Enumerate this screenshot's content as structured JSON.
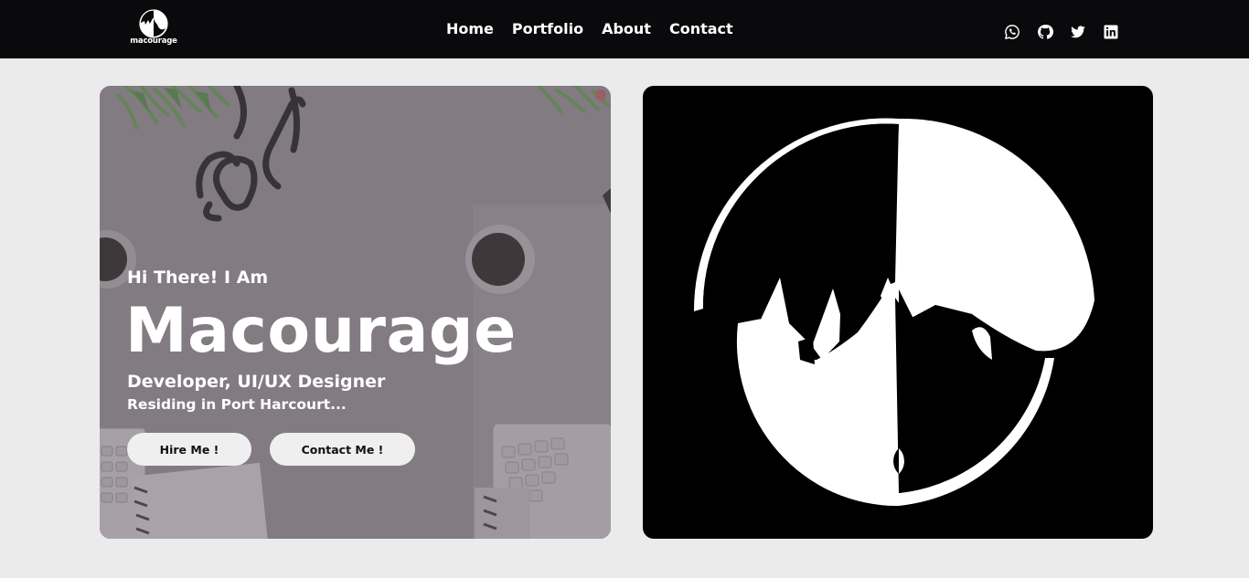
{
  "brand": {
    "name": "macourage"
  },
  "nav": {
    "links": [
      {
        "label": "Home"
      },
      {
        "label": "Portfolio"
      },
      {
        "label": "About"
      },
      {
        "label": "Contact"
      }
    ]
  },
  "socials": [
    {
      "icon": "whatsapp-icon"
    },
    {
      "icon": "github-icon"
    },
    {
      "icon": "twitter-icon"
    },
    {
      "icon": "linkedin-icon"
    }
  ],
  "hero": {
    "greeting": "Hi There! I Am",
    "name": "Macourage",
    "role": "Developer, UI/UX Designer",
    "location": "Residing in Port Harcourt...",
    "hire_label": "Hire Me !",
    "contact_label": "Contact Me !"
  },
  "colors": {
    "navbar_bg": "#0a0a0c",
    "page_bg": "#ebebeb",
    "hero_overlay": "#867f86",
    "button_bg": "#efefef",
    "avatar_bg": "#000000"
  }
}
